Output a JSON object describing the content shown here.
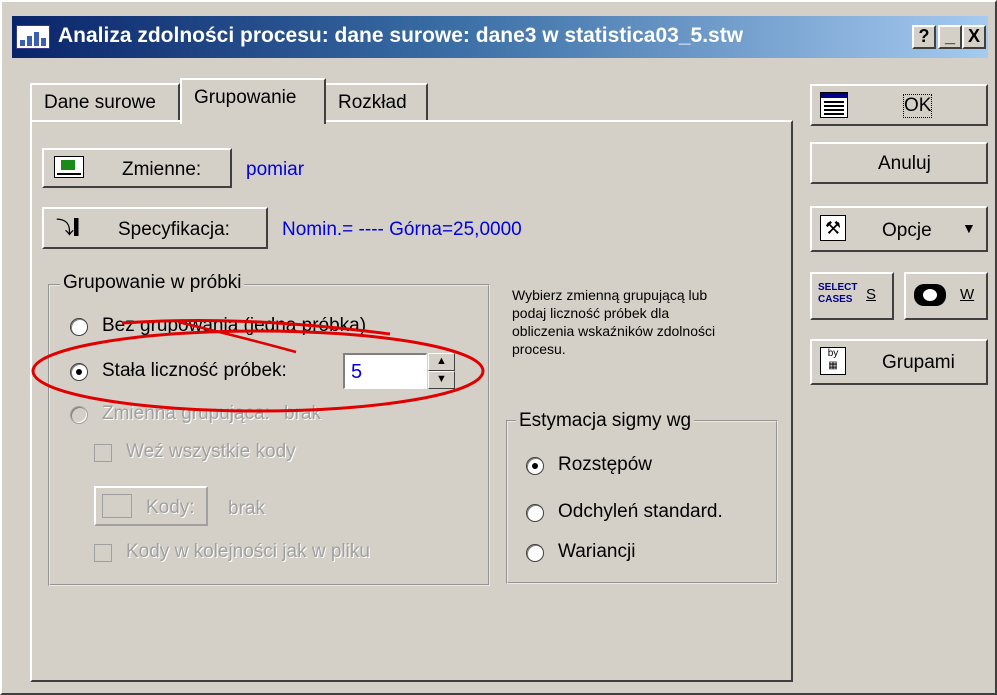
{
  "window": {
    "title": "Analiza zdolności procesu: dane surowe: dane3 w statistica03_5.stw",
    "controls": {
      "help": "?",
      "minimize": "_",
      "close": "X"
    }
  },
  "tabs": [
    {
      "label": "Dane surowe"
    },
    {
      "label": "Grupowanie"
    },
    {
      "label": "Rozkład"
    }
  ],
  "variables": {
    "button_label": "Zmienne:",
    "value": "pomiar"
  },
  "specification": {
    "button_label": "Specyfikacja:",
    "value": "Nomin.=  ----   Górna=25,0000"
  },
  "grouping_box": {
    "title": "Grupowanie w próbki",
    "option_none": "Bez grupowania (jedna próbka)",
    "option_constant": "Stała liczność próbek:",
    "sample_size": "5",
    "option_variable": "Zmienna grupująca:",
    "grouping_variable_value": "brak",
    "all_codes_label": "Weź wszystkie kody",
    "codes_button_label": "Kody:",
    "codes_value": "brak",
    "codes_order_label": "Kody w kolejności jak w pliku"
  },
  "hint": {
    "lines": [
      "Wybierz zmienną grupującą lub",
      "podaj liczność próbek dla",
      "obliczenia wskaźników zdolności",
      "procesu."
    ]
  },
  "sigma_box": {
    "title": "Estymacja sigmy wg",
    "options": [
      "Rozstępów",
      "Odchyleń standard.",
      "Wariancji"
    ]
  },
  "side_buttons": {
    "ok": "OK",
    "cancel": "Anuluj",
    "options": "Opcje",
    "select_cases_icon_text": [
      "SELECT",
      "CASES"
    ],
    "select_cases_key": "S",
    "weight_key": "W",
    "by_groups": "Grupami"
  },
  "colors": {
    "accent_blue": "#0000e0",
    "annotation_red": "#e00000"
  }
}
